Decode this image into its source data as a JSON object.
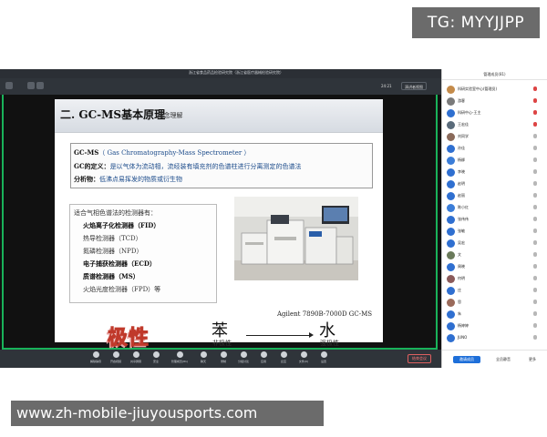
{
  "watermark": {
    "telegram": "TG: MYYJJPP",
    "site": "www.zh-mobile-jiuyousports.com"
  },
  "window": {
    "title": "浙江省食品药品检验研究院（浙江省医疗器械检验研究院）",
    "time": "24:21",
    "view_button": "演讲者视图"
  },
  "slide": {
    "title": "二. GC-MS基本原理",
    "subtitle": "-概念理解",
    "definitions": [
      {
        "term": "GC-MS",
        "text": "（ Gas Chromatography-Mass Spectrometer ）"
      },
      {
        "term": "GC的定义：",
        "text": "是以气体为流动相，流经装有填充剂的色谱柱进行分离测定的色谱法"
      },
      {
        "term": "分析物：",
        "text": "低沸点易挥发的物质或衍生物"
      }
    ],
    "detectors_heading": "适合气相色谱法的检测器有：",
    "detectors": [
      {
        "text": "火焰离子化检测器（FID）",
        "bold": true
      },
      {
        "text": "热导检测器（TCD）",
        "bold": false
      },
      {
        "text": "氮磷检测器（NPD）",
        "bold": false
      },
      {
        "text": "电子捕获检测器（ECD）",
        "bold": true
      },
      {
        "text": "质谱检测器（MS）",
        "bold": true
      },
      {
        "text": "火焰光度检测器（FPD）等",
        "bold": false
      }
    ],
    "photo_caption": "Agilent 7890B-7000D GC-MS",
    "polarity": "极性",
    "compound_left": "苯",
    "compound_left_label": "非极性",
    "compound_right": "水",
    "compound_right_label": "强极性"
  },
  "toolbar": {
    "items": [
      "解除静音",
      "开启视频",
      "共享屏幕",
      "安全",
      "管理成员(81)",
      "聊天",
      "录制",
      "分组讨论",
      "应用",
      "反应",
      "文件(0)",
      "设置"
    ],
    "leave": "结束会议"
  },
  "members": {
    "title": "管理成员(81)",
    "list": [
      {
        "name": "科研实验室中心(管理员)",
        "color": "#c48b4a",
        "mic": "red"
      },
      {
        "name": "游客",
        "color": "#7a7a7a",
        "mic": "red"
      },
      {
        "name": "科研中心-王主",
        "color": "#2f6fd0",
        "mic": "red"
      },
      {
        "name": "王宏佳",
        "color": "#5a6b7a",
        "mic": "red"
      },
      {
        "name": "刘同学",
        "color": "#8a6a5a",
        "mic": "gray"
      },
      {
        "name": "孙佳",
        "color": "#2f6fd0",
        "mic": "gray"
      },
      {
        "name": "杨柳",
        "color": "#3b7dd8",
        "mic": "gray"
      },
      {
        "name": "李晓",
        "color": "#2f6fd0",
        "mic": "gray"
      },
      {
        "name": "赵明",
        "color": "#2f6fd0",
        "mic": "gray"
      },
      {
        "name": "赵丽",
        "color": "#2f6fd0",
        "mic": "gray"
      },
      {
        "name": "陈小红",
        "color": "#3b7dd8",
        "mic": "gray"
      },
      {
        "name": "张伟伟",
        "color": "#2f6fd0",
        "mic": "gray"
      },
      {
        "name": "张敏",
        "color": "#2f6fd0",
        "mic": "gray"
      },
      {
        "name": "吴宏",
        "color": "#2f6fd0",
        "mic": "gray"
      },
      {
        "name": "文",
        "color": "#6a7a5a",
        "mic": "gray"
      },
      {
        "name": "周晓",
        "color": "#2f6fd0",
        "mic": "gray"
      },
      {
        "name": "何明",
        "color": "#8a5a5a",
        "mic": "gray"
      },
      {
        "name": "庄",
        "color": "#2f6fd0",
        "mic": "gray"
      },
      {
        "name": "思",
        "color": "#9a6a5a",
        "mic": "gray"
      },
      {
        "name": "朱",
        "color": "#2f6fd0",
        "mic": "gray"
      },
      {
        "name": "杨婷婷",
        "color": "#2f6fd0",
        "mic": "gray"
      },
      {
        "name": "JUNO",
        "color": "#2f6fd0",
        "mic": "gray"
      }
    ],
    "invite": "邀请成员",
    "mute_all": "全员静音",
    "more": "更多"
  }
}
